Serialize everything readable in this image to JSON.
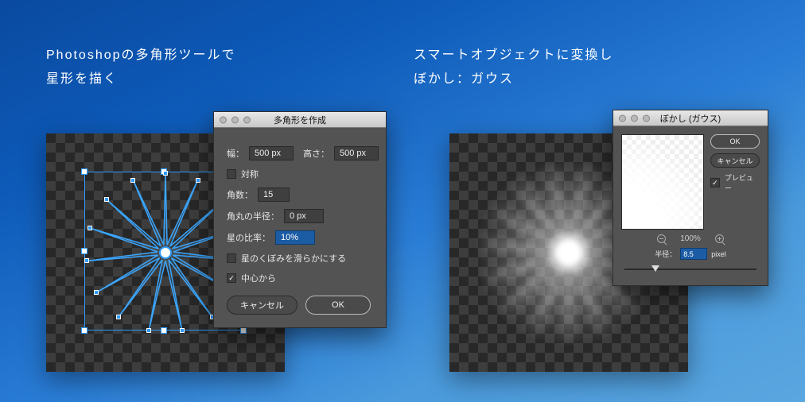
{
  "captions": {
    "left_line1": "Photoshopの多角形ツールで",
    "left_line2": "星形を描く",
    "right_line1": "スマートオブジェクトに変換し",
    "right_line2": "ぼかし：ガウス"
  },
  "polygon_dialog": {
    "title": "多角形を作成",
    "width_label": "幅：",
    "width_value": "500 px",
    "height_label": "高さ：",
    "height_value": "500 px",
    "symmetric_label": "対称",
    "symmetric_checked": false,
    "vertices_label": "角数：",
    "vertices_value": "15",
    "corner_radius_label": "角丸の半径：",
    "corner_radius_value": "0 px",
    "star_ratio_label": "星の比率：",
    "star_ratio_value": "10%",
    "smooth_label": "星のくぼみを滑らかにする",
    "smooth_checked": false,
    "from_center_label": "中心から",
    "from_center_checked": true,
    "cancel": "キャンセル",
    "ok": "OK"
  },
  "gaussian_dialog": {
    "title": "ぼかし (ガウス)",
    "ok": "OK",
    "cancel": "キャンセル",
    "preview_label": "プレビュー",
    "preview_checked": true,
    "zoom": "100%",
    "radius_label": "半径：",
    "radius_value": "8.5",
    "radius_unit": "pixel",
    "slider_pos_percent": 22
  },
  "star": {
    "points": 15
  }
}
